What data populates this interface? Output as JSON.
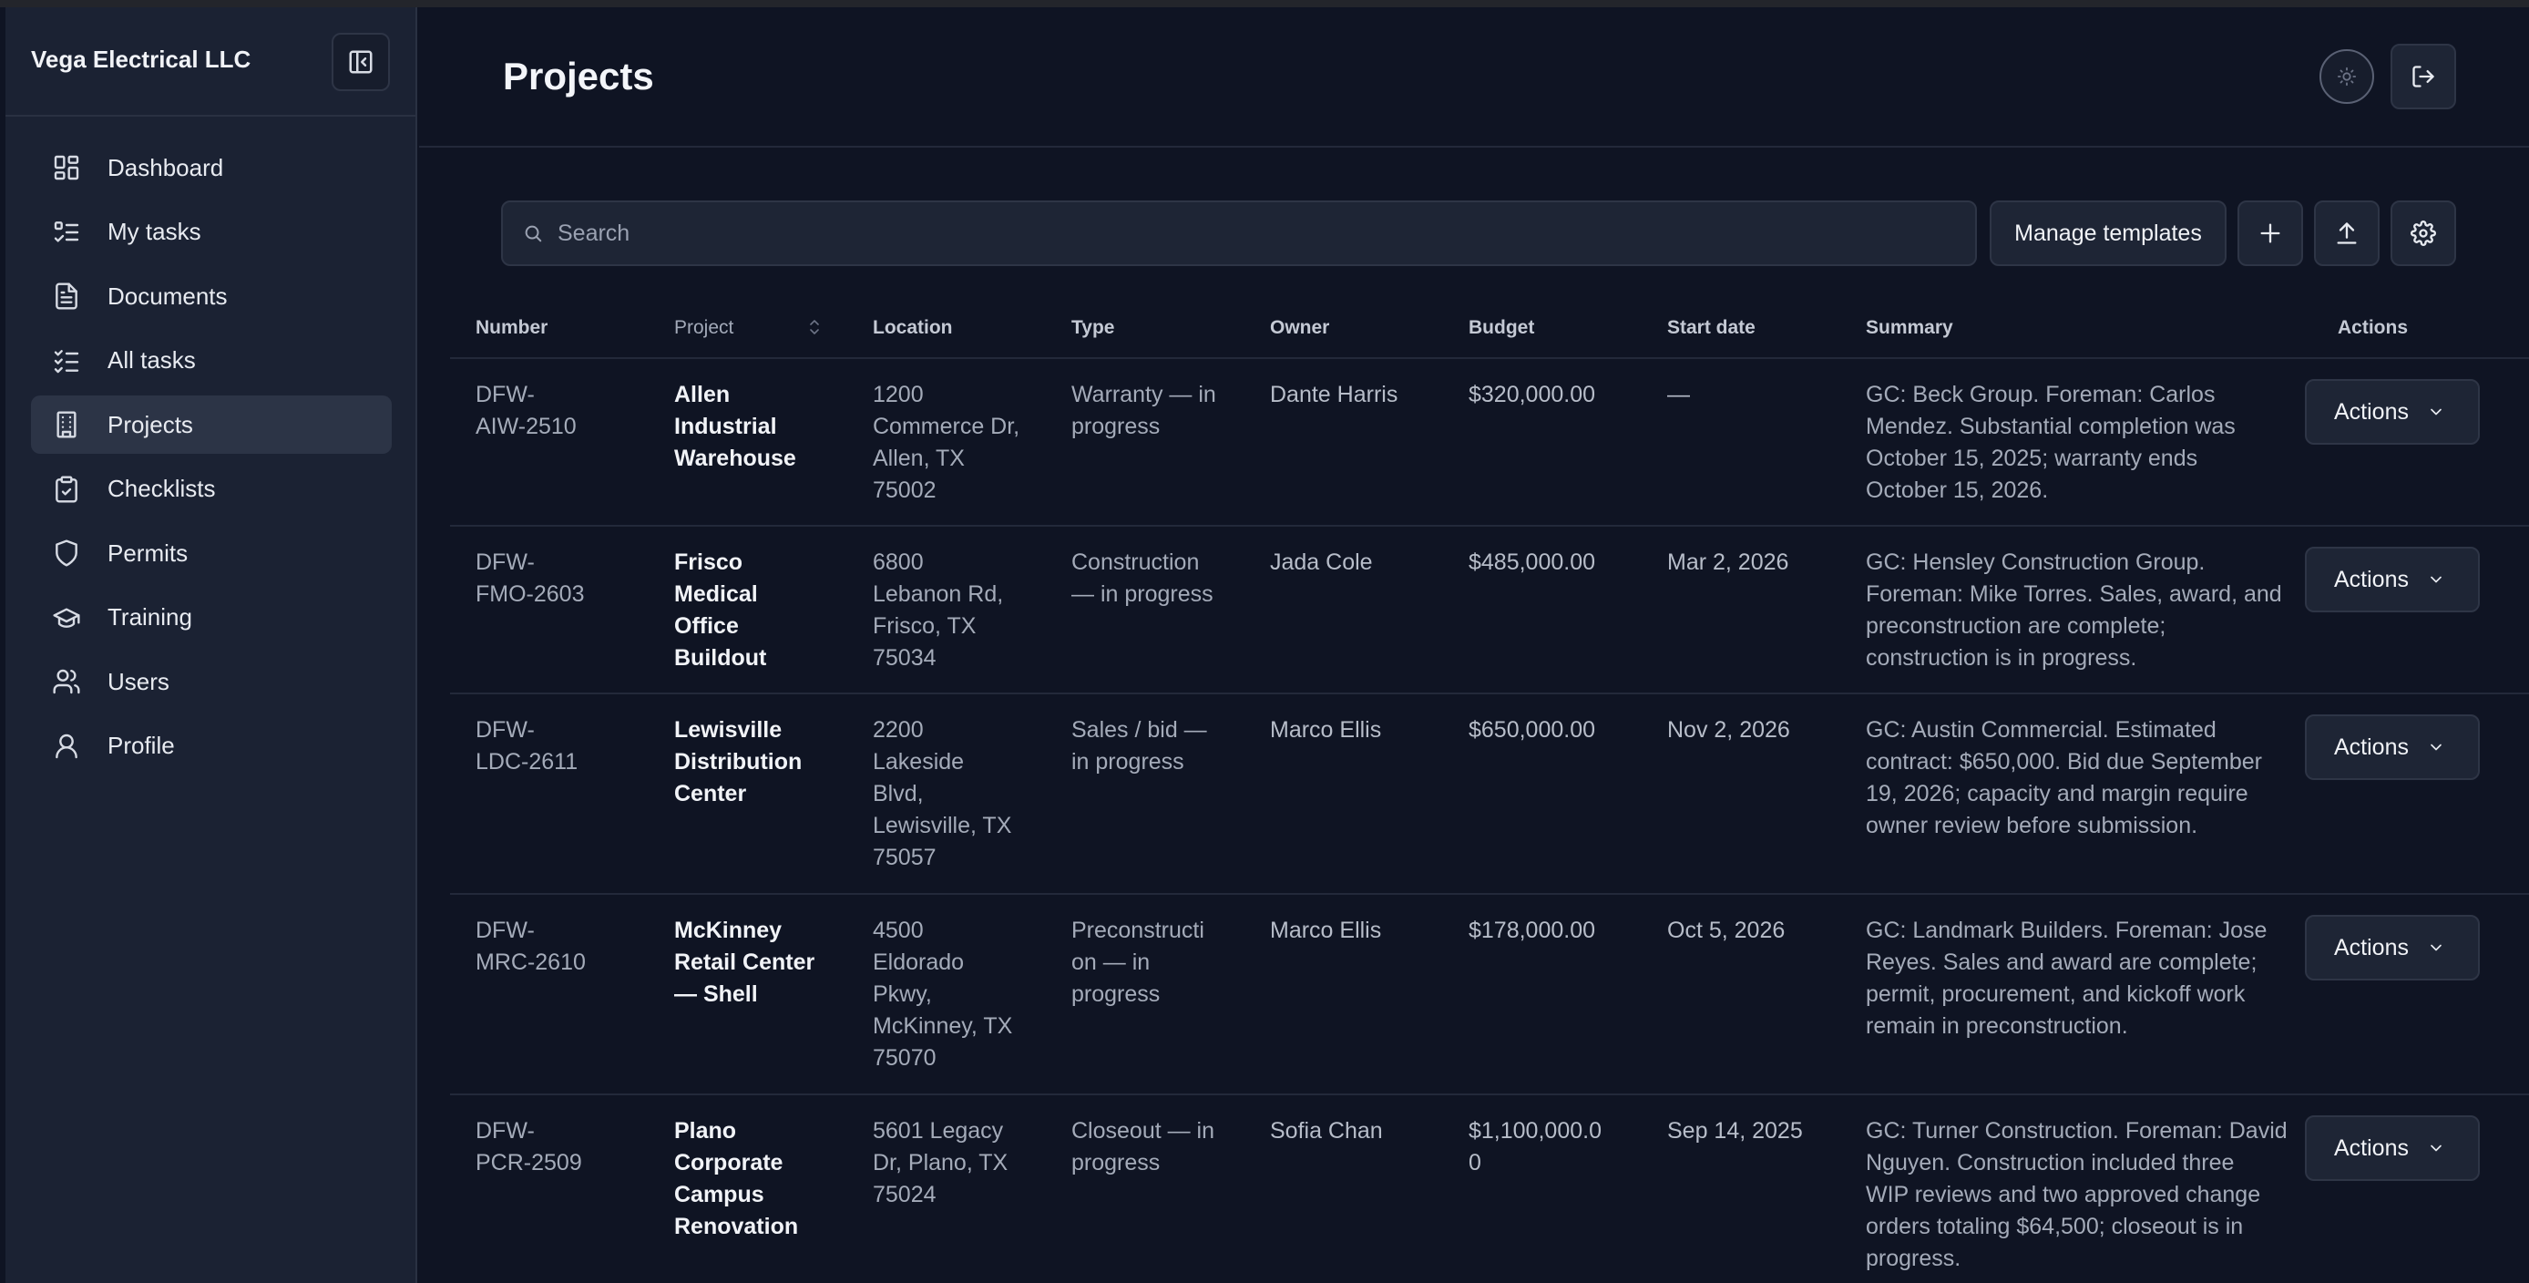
{
  "sidebar": {
    "company": "Vega Electrical LLC",
    "items": [
      {
        "label": "Dashboard",
        "icon": "dashboard-icon",
        "active": false
      },
      {
        "label": "My tasks",
        "icon": "list-check-icon",
        "active": false
      },
      {
        "label": "Documents",
        "icon": "document-icon",
        "active": false
      },
      {
        "label": "All tasks",
        "icon": "checklist-icon",
        "active": false
      },
      {
        "label": "Projects",
        "icon": "building-icon",
        "active": true
      },
      {
        "label": "Checklists",
        "icon": "clipboard-check-icon",
        "active": false
      },
      {
        "label": "Permits",
        "icon": "shield-icon",
        "active": false
      },
      {
        "label": "Training",
        "icon": "graduation-cap-icon",
        "active": false
      },
      {
        "label": "Users",
        "icon": "users-icon",
        "active": false
      },
      {
        "label": "Profile",
        "icon": "user-icon",
        "active": false
      }
    ]
  },
  "header": {
    "title": "Projects"
  },
  "toolbar": {
    "search_placeholder": "Search",
    "manage_templates_label": "Manage templates"
  },
  "table": {
    "columns": [
      "Number",
      "Project",
      "Location",
      "Type",
      "Owner",
      "Budget",
      "Start date",
      "Summary",
      "Actions"
    ],
    "action_label": "Actions",
    "rows": [
      {
        "number": "DFW-\nAIW-2510",
        "project": "Allen\nIndustrial\nWarehouse",
        "location": "1200\nCommerce Dr,\nAllen, TX\n75002",
        "type": "Warranty — in\nprogress",
        "owner": "Dante Harris",
        "budget": "$320,000.00",
        "start_date": "—",
        "summary": "GC: Beck Group. Foreman: Carlos\nMendez. Substantial completion was\nOctober 15, 2025; warranty ends\nOctober 15, 2026."
      },
      {
        "number": "DFW-\nFMO-2603",
        "project": "Frisco\nMedical\nOffice\nBuildout",
        "location": "6800\nLebanon Rd,\nFrisco, TX\n75034",
        "type": "Construction\n— in progress",
        "owner": "Jada Cole",
        "budget": "$485,000.00",
        "start_date": "Mar 2, 2026",
        "summary": "GC: Hensley Construction Group.\nForeman: Mike Torres. Sales, award, and\npreconstruction are complete;\nconstruction is in progress."
      },
      {
        "number": "DFW-\nLDC-2611",
        "project": "Lewisville\nDistribution\nCenter",
        "location": "2200\nLakeside\nBlvd,\nLewisville, TX\n75057",
        "type": "Sales / bid —\nin progress",
        "owner": "Marco Ellis",
        "budget": "$650,000.00",
        "start_date": "Nov 2, 2026",
        "summary": "GC: Austin Commercial. Estimated\ncontract: $650,000. Bid due September\n19, 2026; capacity and margin require\nowner review before submission."
      },
      {
        "number": "DFW-\nMRC-2610",
        "project": "McKinney\nRetail Center\n— Shell",
        "location": "4500\nEldorado\nPkwy,\nMcKinney, TX\n75070",
        "type": "Preconstructi\non — in\nprogress",
        "owner": "Marco Ellis",
        "budget": "$178,000.00",
        "start_date": "Oct 5, 2026",
        "summary": "GC: Landmark Builders. Foreman: Jose\nReyes. Sales and award are complete;\npermit, procurement, and kickoff work\nremain in preconstruction."
      },
      {
        "number": "DFW-\nPCR-2509",
        "project": "Plano\nCorporate\nCampus\nRenovation",
        "location": "5601 Legacy\nDr, Plano, TX\n75024",
        "type": "Closeout — in\nprogress",
        "owner": "Sofia Chan",
        "budget": "$1,100,000.0\n0",
        "start_date": "Sep 14, 2025",
        "summary": "GC: Turner Construction. Foreman: David\nNguyen. Construction included three\nWIP reviews and two approved change\norders totaling $64,500; closeout is in\nprogress."
      }
    ]
  }
}
